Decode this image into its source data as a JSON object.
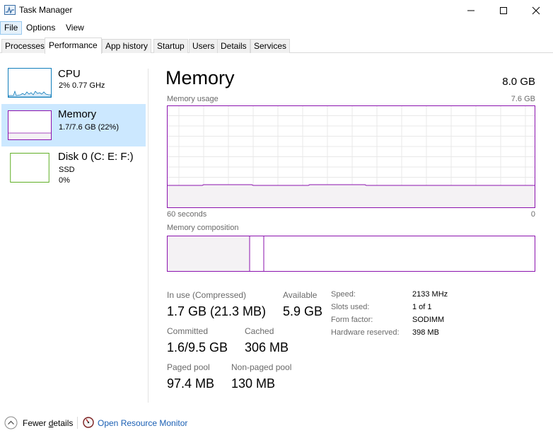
{
  "window": {
    "title": "Task Manager",
    "icon": "task-manager-icon",
    "controls": [
      "minimize-icon",
      "maximize-icon",
      "close-icon"
    ]
  },
  "menu": [
    "File",
    "Options",
    "View"
  ],
  "tabs": [
    "Processes",
    "Performance",
    "App history",
    "Startup",
    "Users",
    "Details",
    "Services"
  ],
  "active_tab": "Performance",
  "sidebar": {
    "items": [
      {
        "title": "CPU",
        "line1": "2%  0.77 GHz",
        "line2": ""
      },
      {
        "title": "Memory",
        "line1": "1.7/7.6 GB (22%)",
        "line2": ""
      },
      {
        "title": "Disk 0 (C: E: F:)",
        "line1": "SSD",
        "line2": "0%"
      }
    ],
    "selected": "Memory",
    "colors": {
      "cpu": "#117dbb",
      "memory": "#8b12ae",
      "disk": "#4da60c"
    }
  },
  "main": {
    "title": "Memory",
    "total": "8.0 GB",
    "usage_label": "Memory usage",
    "usage_max": "7.6 GB",
    "time_left": "60 seconds",
    "time_right": "0",
    "composition_label": "Memory composition",
    "usage_fraction": 0.22,
    "composition": {
      "in_use_gb": 1.7,
      "modified_gb": 0.2,
      "total_gb": 7.6
    },
    "stats": {
      "in_use_label": "In use (Compressed)",
      "in_use_value": "1.7 GB (21.3 MB)",
      "available_label": "Available",
      "available_value": "5.9 GB",
      "committed_label": "Committed",
      "committed_value": "1.6/9.5 GB",
      "cached_label": "Cached",
      "cached_value": "306 MB",
      "paged_label": "Paged pool",
      "paged_value": "97.4 MB",
      "nonpaged_label": "Non-paged pool",
      "nonpaged_value": "130 MB"
    },
    "specs": {
      "speed_label": "Speed:",
      "speed_value": "2133 MHz",
      "slots_label": "Slots used:",
      "slots_value": "1 of 1",
      "form_label": "Form factor:",
      "form_value": "SODIMM",
      "reserved_label": "Hardware reserved:",
      "reserved_value": "398 MB"
    }
  },
  "footer": {
    "fewer_details": "Fewer details",
    "open_monitor": "Open Resource Monitor"
  }
}
